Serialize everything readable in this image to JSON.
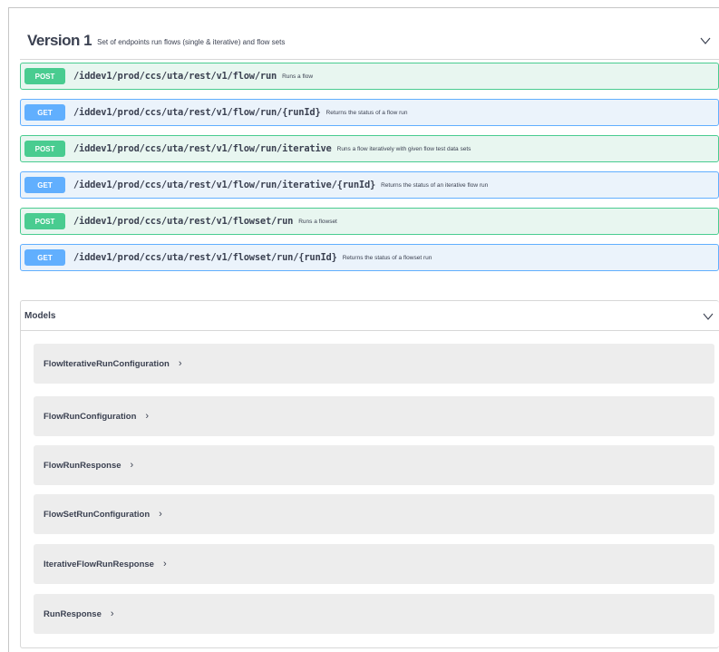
{
  "version": {
    "title": "Version 1",
    "description": "Set of endpoints run flows (single & iterative) and flow sets",
    "chevron_icon": "chevron-down-icon"
  },
  "operations": [
    {
      "method": "POST",
      "path": "/iddev1/prod/ccs/uta/rest/v1/flow/run",
      "summary": "Runs a flow"
    },
    {
      "method": "GET",
      "path": "/iddev1/prod/ccs/uta/rest/v1/flow/run/{runId}",
      "summary": "Returns the status of a flow run"
    },
    {
      "method": "POST",
      "path": "/iddev1/prod/ccs/uta/rest/v1/flow/run/iterative",
      "summary": "Runs a flow iteratively with given flow test data sets"
    },
    {
      "method": "GET",
      "path": "/iddev1/prod/ccs/uta/rest/v1/flow/run/iterative/{runId}",
      "summary": "Returns the status of an iterative flow run"
    },
    {
      "method": "POST",
      "path": "/iddev1/prod/ccs/uta/rest/v1/flowset/run",
      "summary": "Runs a flowset"
    },
    {
      "method": "GET",
      "path": "/iddev1/prod/ccs/uta/rest/v1/flowset/run/{runId}",
      "summary": "Returns the status of a flowset run"
    }
  ],
  "models": {
    "title": "Models",
    "chevron_icon": "chevron-down-icon",
    "items": [
      {
        "name": "FlowIterativeRunConfiguration",
        "arrow": "›"
      },
      {
        "name": "FlowRunConfiguration",
        "arrow": "›"
      },
      {
        "name": "FlowRunResponse",
        "arrow": "›"
      },
      {
        "name": "FlowSetRunConfiguration",
        "arrow": "›"
      },
      {
        "name": "IterativeFlowRunResponse",
        "arrow": "›"
      },
      {
        "name": "RunResponse",
        "arrow": "›"
      }
    ]
  },
  "colors": {
    "post": "#49cc90",
    "post_bg": "#e8f6f0",
    "get": "#61affe",
    "get_bg": "#ebf3fb",
    "model_bg": "#ededed",
    "text": "#3b4151"
  }
}
